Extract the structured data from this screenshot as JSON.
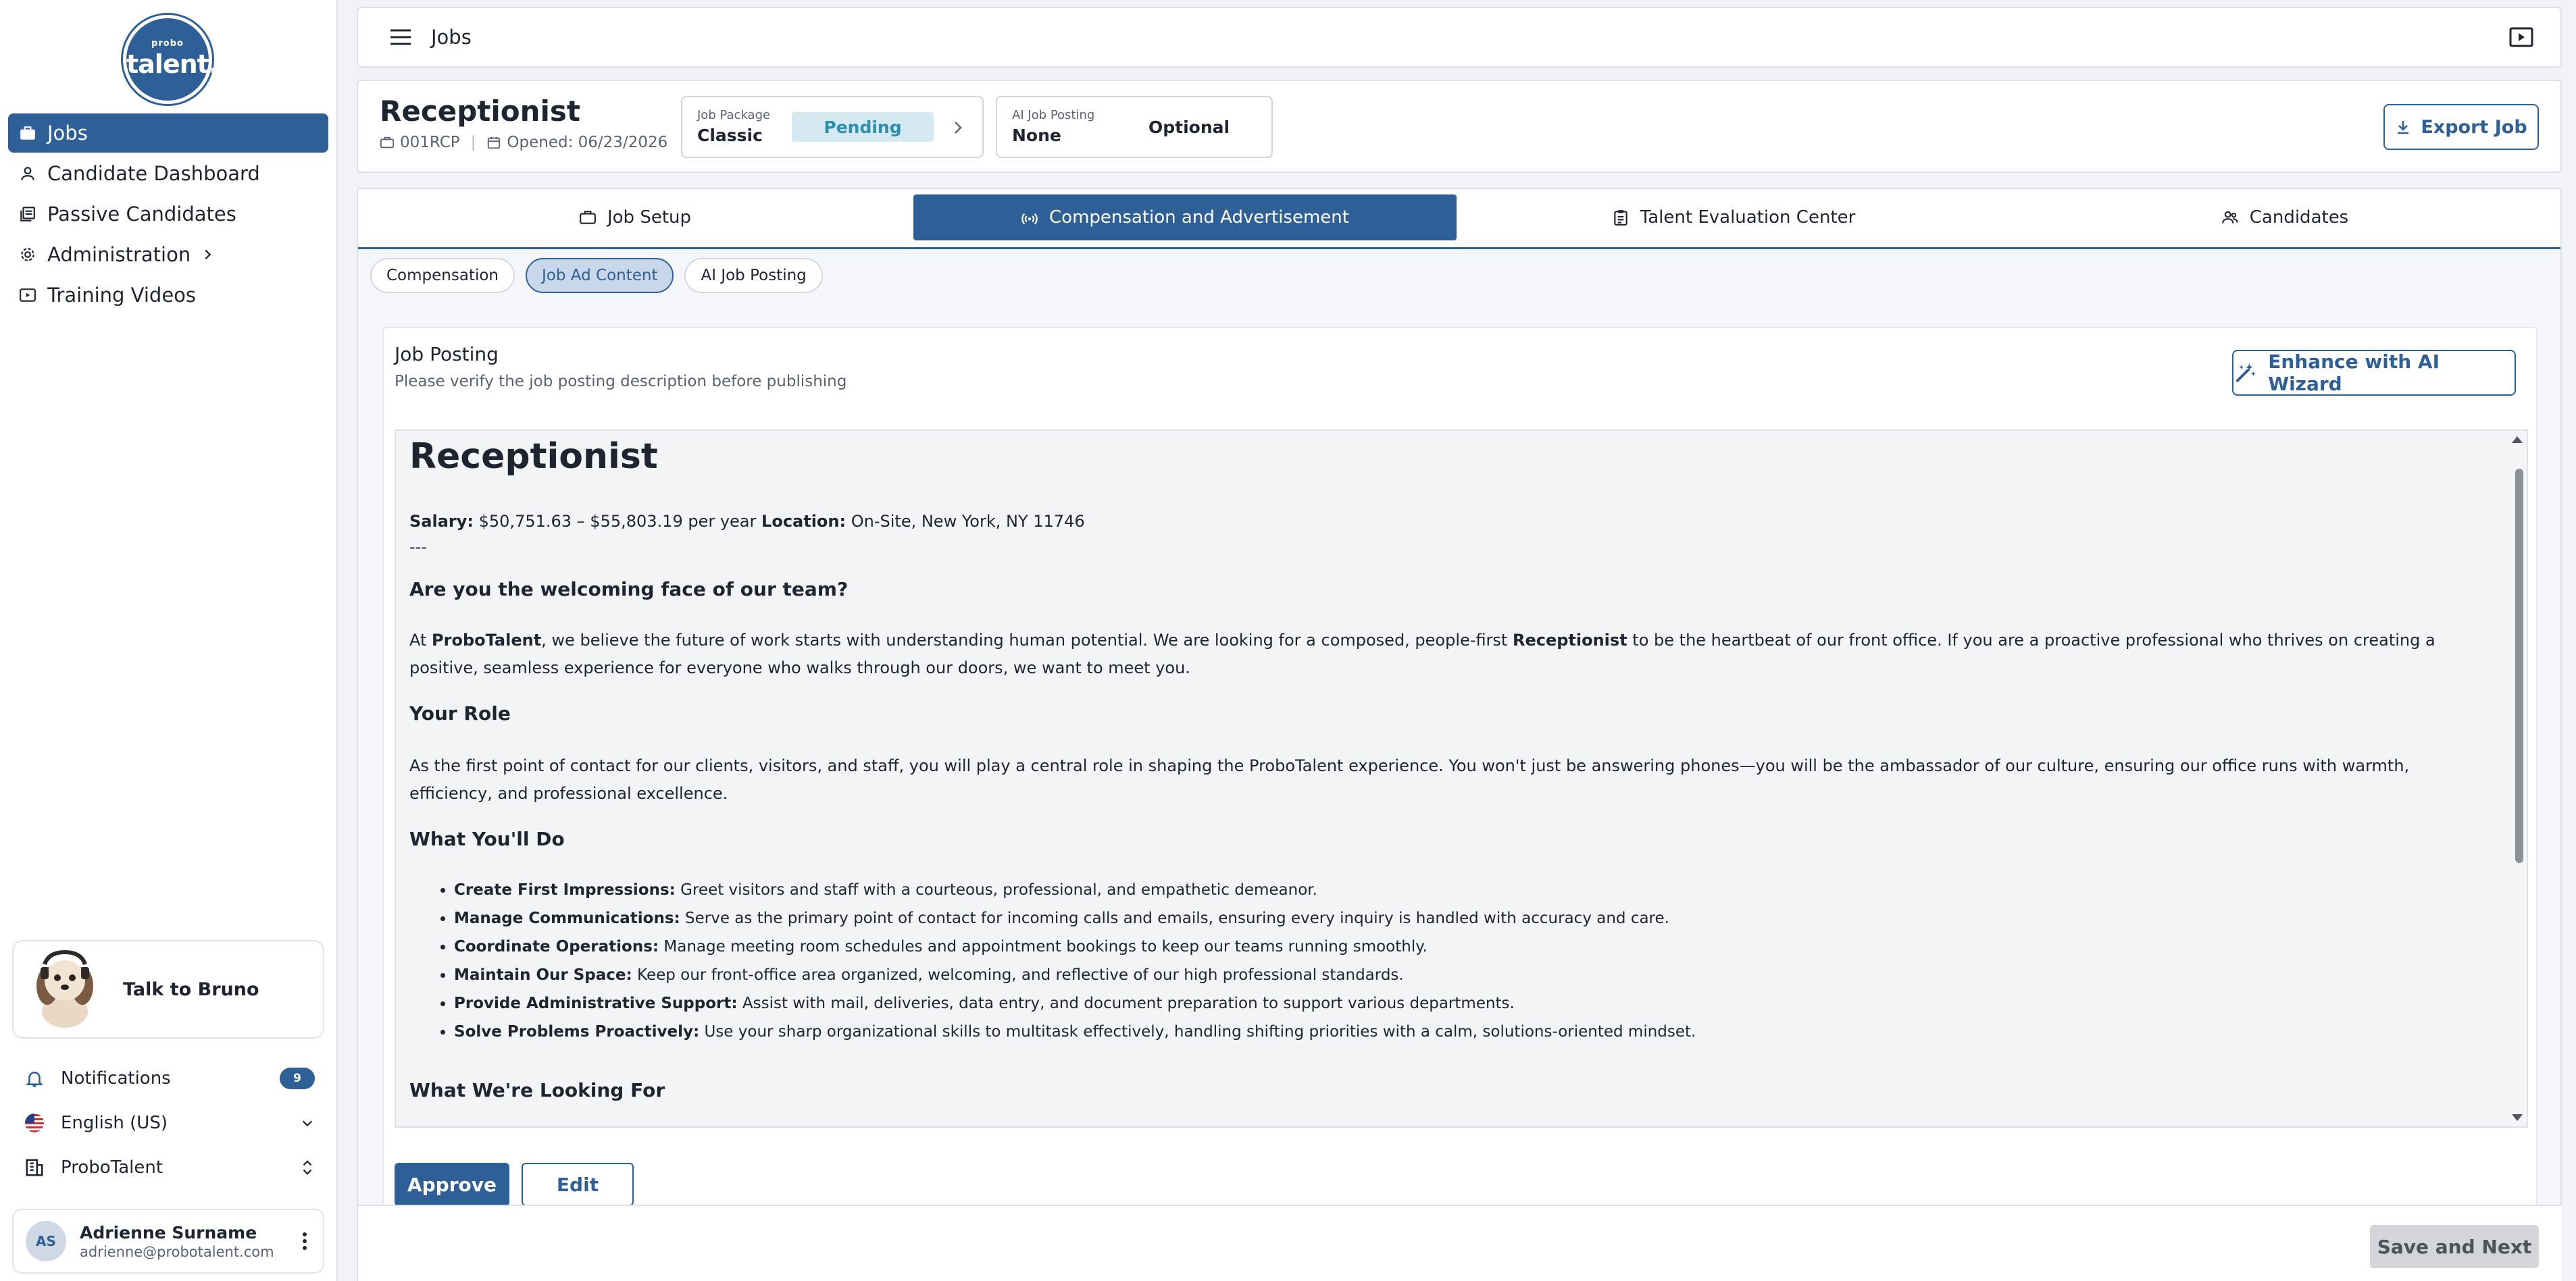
{
  "brand": {
    "logo_small": "probo",
    "logo_big": "talent."
  },
  "sidebar": {
    "items": [
      {
        "label": "Jobs",
        "icon": "briefcase-icon",
        "active": true
      },
      {
        "label": "Candidate Dashboard",
        "icon": "person-icon"
      },
      {
        "label": "Passive Candidates",
        "icon": "documents-icon"
      },
      {
        "label": "Administration",
        "icon": "gear-icon"
      },
      {
        "label": "Training Videos",
        "icon": "video-icon"
      }
    ],
    "assistant_label": "Talk to Bruno",
    "notifications_label": "Notifications",
    "notifications_count": "9",
    "language": "English (US)",
    "organization": "ProboTalent",
    "user": {
      "initials": "AS",
      "name": "Adrienne Surname",
      "email": "adrienne@probotalent.com"
    }
  },
  "topbar": {
    "title": "Jobs"
  },
  "job": {
    "title": "Receptionist",
    "code": "001RCP",
    "opened": "Opened: 06/23/2026",
    "package_label": "Job Package",
    "package_value": "Classic",
    "package_status": "Pending",
    "ai_label": "AI Job Posting",
    "ai_value": "None",
    "ai_status": "Optional",
    "export_label": "Export Job"
  },
  "tabs": [
    {
      "label": "Job Setup",
      "icon": "briefcase-icon"
    },
    {
      "label": "Compensation and Advertisement",
      "icon": "broadcast-icon",
      "active": true
    },
    {
      "label": "Talent Evaluation Center",
      "icon": "clipboard-icon"
    },
    {
      "label": "Candidates",
      "icon": "people-icon"
    }
  ],
  "subtabs": [
    {
      "label": "Compensation"
    },
    {
      "label": "Job Ad Content",
      "active": true
    },
    {
      "label": "AI Job Posting"
    }
  ],
  "posting": {
    "title": "Job Posting",
    "subtitle": "Please verify the job posting description before publishing",
    "wizard_label": "Enhance with AI Wizard",
    "doc": {
      "heading": "Receptionist",
      "salary_label": "Salary:",
      "salary_value": "$50,751.63 – $55,803.19 per year",
      "location_label": "Location:",
      "location_value": "On-Site, New York, NY 11746",
      "divider": "---",
      "h_welcome": "Are you the welcoming face of our team?",
      "p1_a": "At ",
      "p1_company": "ProboTalent",
      "p1_b": ", we believe the future of work starts with understanding human potential. We are looking for a composed, people-first ",
      "p1_role": "Receptionist",
      "p1_c": " to be the heartbeat of our front office. If you are a proactive professional who thrives on creating a positive, seamless experience for everyone who walks through our doors, we want to meet you.",
      "h_role": "Your Role",
      "p2": "As the first point of contact for our clients, visitors, and staff, you will play a central role in shaping the ProboTalent experience. You won't just be answering phones—you will be the ambassador of our culture, ensuring our office runs with warmth, efficiency, and professional excellence.",
      "h_do": "What You'll Do",
      "bullets": [
        {
          "bold": "Create First Impressions:",
          "text": " Greet visitors and staff with a courteous, professional, and empathetic demeanor."
        },
        {
          "bold": "Manage Communications:",
          "text": " Serve as the primary point of contact for incoming calls and emails, ensuring every inquiry is handled with accuracy and care."
        },
        {
          "bold": "Coordinate Operations:",
          "text": " Manage meeting room schedules and appointment bookings to keep our teams running smoothly."
        },
        {
          "bold": "Maintain Our Space:",
          "text": " Keep our front-office area organized, welcoming, and reflective of our high professional standards."
        },
        {
          "bold": "Provide Administrative Support:",
          "text": " Assist with mail, deliveries, data entry, and document preparation to support various departments."
        },
        {
          "bold": "Solve Problems Proactively:",
          "text": " Use your sharp organizational skills to multitask effectively, handling shifting priorities with a calm, solutions-oriented mindset."
        }
      ],
      "h_looking": "What We're Looking For"
    },
    "approve_label": "Approve",
    "edit_label": "Edit"
  },
  "footer": {
    "save_next_label": "Save and Next"
  },
  "colors": {
    "primary": "#2e5f96",
    "pending_bg": "#d5e9f0",
    "pending_text": "#2d8fae"
  }
}
